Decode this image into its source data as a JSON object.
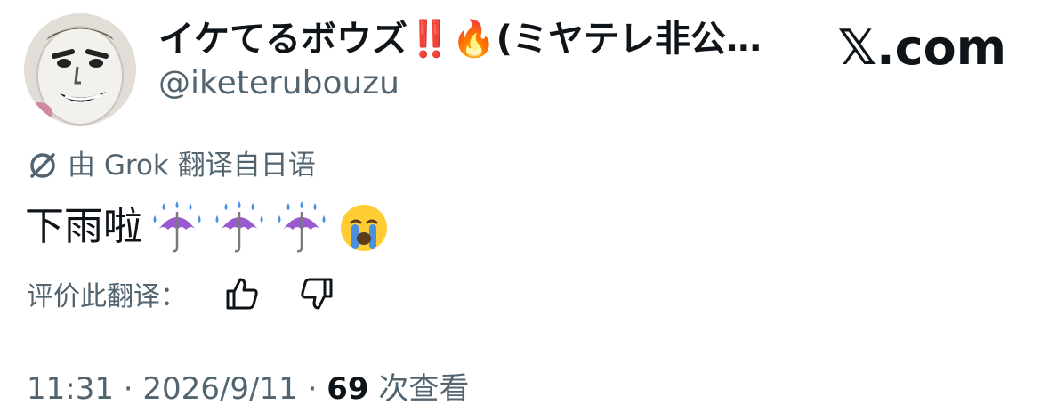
{
  "author": {
    "display_name": "イケてるボウズ",
    "name_emoji": "‼️🔥",
    "name_tail": "(ミヤテレ非公…",
    "handle": "@iketerubouzu"
  },
  "brand": {
    "logo_text": "𝕏.com"
  },
  "translation": {
    "label": "由 Grok 翻译自日语",
    "icon": "slash-circle-icon"
  },
  "tweet": {
    "text": "下雨啦",
    "emojis": [
      "umbrella-rain-icon",
      "umbrella-rain-icon",
      "umbrella-rain-icon",
      "crying-face-icon"
    ]
  },
  "rating": {
    "label": "评价此翻译：",
    "like_icon": "thumbs-up-icon",
    "dislike_icon": "thumbs-down-icon"
  },
  "meta": {
    "time": "11:31",
    "sep1": " · ",
    "date": "2026/9/11",
    "sep2": " · ",
    "views_count": "69",
    "views_label": " 次查看"
  },
  "colors": {
    "text_primary": "#0f1419",
    "text_secondary": "#536471",
    "emoji_red": "#e0245e",
    "umbrella_purple": "#9b59d0",
    "raindrop_blue": "#4a90e2",
    "cry_face_yellow": "#ffcc33"
  }
}
